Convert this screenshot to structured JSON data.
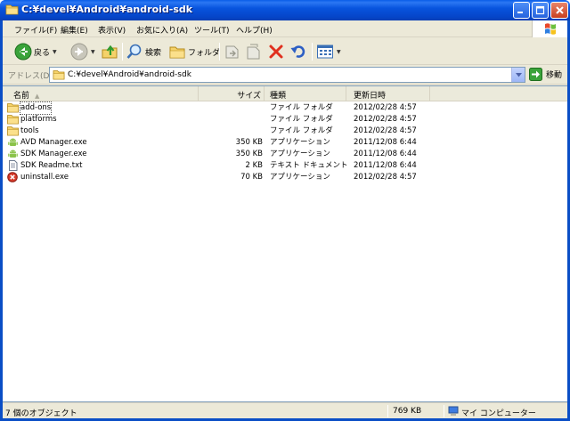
{
  "window": {
    "title": "C:¥devel¥Android¥android-sdk"
  },
  "menu": {
    "items": [
      "ファイル(F)",
      "編集(E)",
      "表示(V)",
      "お気に入り(A)",
      "ツール(T)",
      "ヘルプ(H)"
    ]
  },
  "toolbar": {
    "back_label": "戻る",
    "search_label": "検索",
    "folders_label": "フォルダ"
  },
  "address": {
    "label": "アドレス(D)",
    "value": "C:¥devel¥Android¥android-sdk",
    "go_label": "移動"
  },
  "columns": {
    "name": "名前",
    "size": "サイズ",
    "type": "種類",
    "modified": "更新日時"
  },
  "files": [
    {
      "name": "add-ons",
      "size": "",
      "type": "ファイル フォルダ",
      "modified": "2012/02/28 4:57",
      "icon": "folder-icon"
    },
    {
      "name": "platforms",
      "size": "",
      "type": "ファイル フォルダ",
      "modified": "2012/02/28 4:57",
      "icon": "folder-icon"
    },
    {
      "name": "tools",
      "size": "",
      "type": "ファイル フォルダ",
      "modified": "2012/02/28 4:57",
      "icon": "folder-icon"
    },
    {
      "name": "AVD Manager.exe",
      "size": "350 KB",
      "type": "アプリケーション",
      "modified": "2011/12/08 6:44",
      "icon": "android-icon"
    },
    {
      "name": "SDK Manager.exe",
      "size": "350 KB",
      "type": "アプリケーション",
      "modified": "2011/12/08 6:44",
      "icon": "android-icon"
    },
    {
      "name": "SDK Readme.txt",
      "size": "2 KB",
      "type": "テキスト ドキュメント",
      "modified": "2011/12/08 6:44",
      "icon": "text-file-icon"
    },
    {
      "name": "uninstall.exe",
      "size": "70 KB",
      "type": "アプリケーション",
      "modified": "2012/02/28 4:57",
      "icon": "uninstall-icon"
    }
  ],
  "status": {
    "object_count": "7 個のオブジェクト",
    "total_size": "769 KB",
    "location": "マイ コンピューター"
  },
  "colors": {
    "title_blue": "#0a4ec6",
    "chrome": "#ece9d8",
    "folder_yellow": "#f5d26a",
    "android_green": "#8bc34a",
    "delete_red": "#e0301e"
  }
}
